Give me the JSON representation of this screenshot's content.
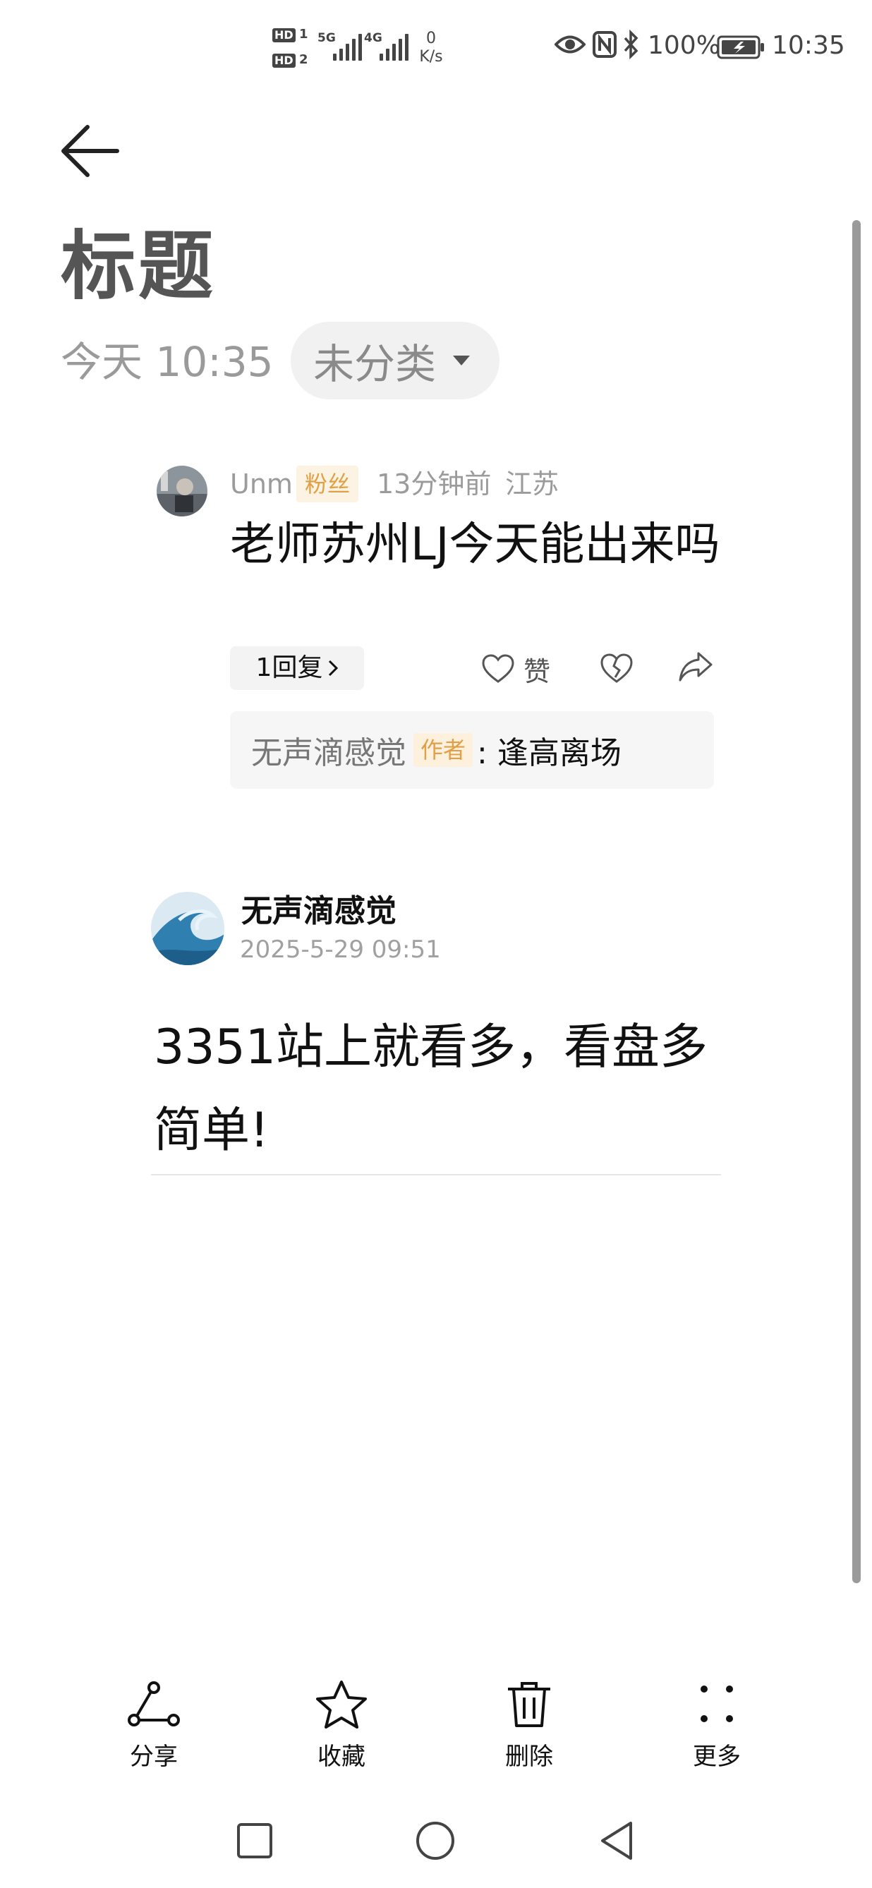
{
  "status_bar": {
    "hd1": "HD",
    "hd1_num": "1",
    "hd2": "HD",
    "hd2_num": "2",
    "sig1": "5G",
    "sig2": "4G",
    "net_speed_value": "0",
    "net_speed_unit": "K/s",
    "battery": "100%",
    "time": "10:35"
  },
  "header": {
    "back_icon": "arrow-left-icon",
    "title": "标题",
    "time": "今天 10:35",
    "category": "未分类"
  },
  "comment": {
    "user": "Unm",
    "badge": "粉丝",
    "time_ago": "13分钟前",
    "location": "江苏",
    "text": "老师苏州LJ今天能出来吗",
    "reply_count": "1回复",
    "like_label": "赞",
    "author_reply": {
      "name": "无声滴感觉",
      "tag": "作者",
      "message": ": 逢高离场"
    }
  },
  "post": {
    "author": "无声滴感觉",
    "date": "2025-5-29 09:51",
    "text": "3351站上就看多，看盘多简单!"
  },
  "toolbar": {
    "share": "分享",
    "favorite": "收藏",
    "delete": "删除",
    "more": "更多"
  },
  "colors": {
    "badge_orange": "#e0a047",
    "muted_gray": "#9b9b9b"
  }
}
